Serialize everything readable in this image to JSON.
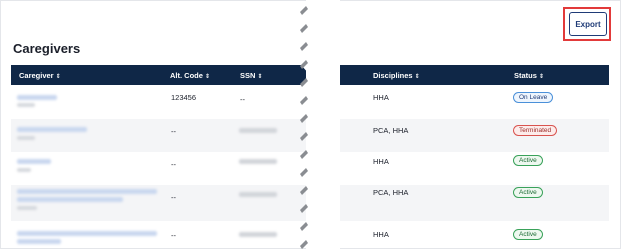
{
  "page": {
    "title": "Caregivers"
  },
  "toolbar": {
    "export_label": "Export"
  },
  "columns": {
    "caregiver": "Caregiver",
    "alt_code": "Alt. Code",
    "ssn": "SSN",
    "disciplines": "Disciplines",
    "status": "Status"
  },
  "sort_glyph": "⇕",
  "rows": [
    {
      "alt_code": "123456",
      "ssn": "--",
      "disciplines": "HHA",
      "status": "On Leave"
    },
    {
      "alt_code": "--",
      "ssn": "",
      "disciplines": "PCA, HHA",
      "status": "Terminated"
    },
    {
      "alt_code": "--",
      "ssn": "",
      "disciplines": "HHA",
      "status": "Active"
    },
    {
      "alt_code": "--",
      "ssn": "",
      "disciplines": "PCA, HHA",
      "status": "Active"
    },
    {
      "alt_code": "--",
      "ssn": "",
      "disciplines": "HHA",
      "status": "Active"
    }
  ],
  "colors": {
    "header_bg": "#0f2747",
    "export_border": "#1f3b77",
    "highlight": "#e23a3a"
  }
}
